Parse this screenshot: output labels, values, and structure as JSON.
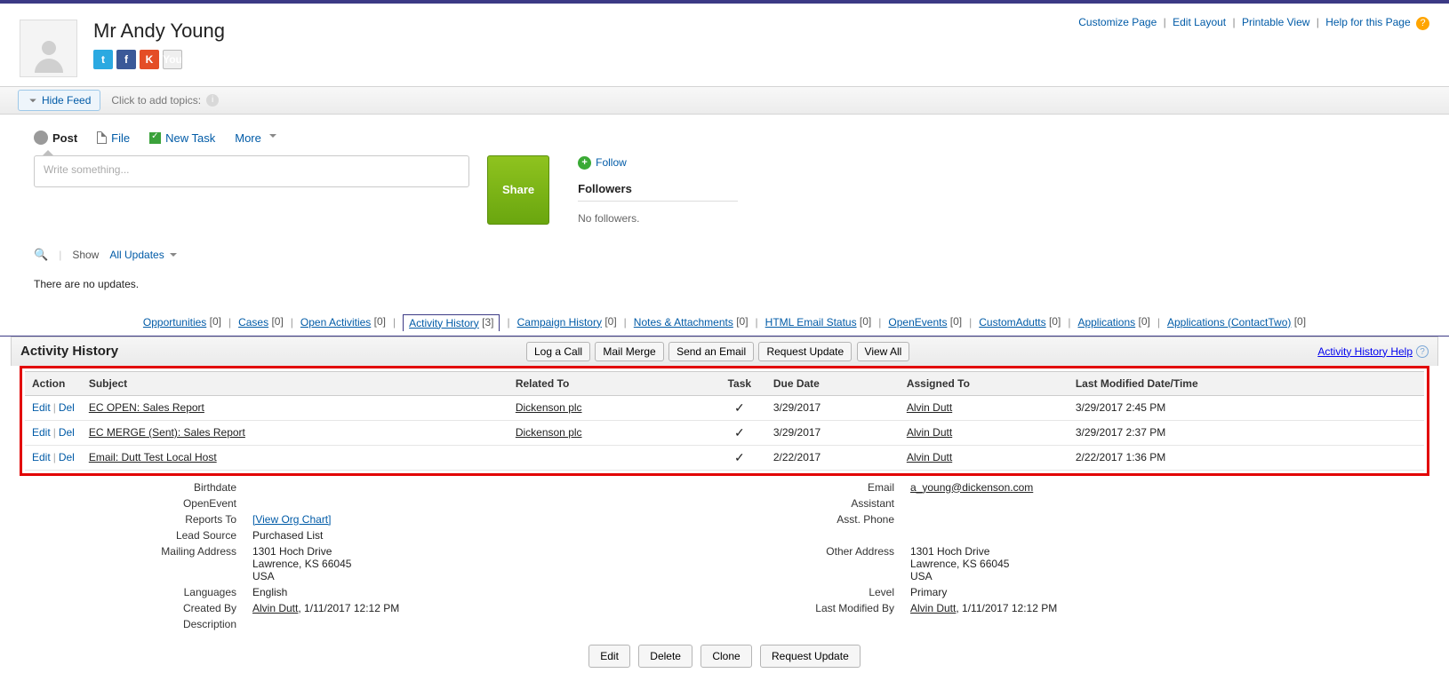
{
  "header": {
    "title": "Mr Andy Young",
    "page_links": {
      "customize": "Customize Page",
      "edit_layout": "Edit Layout",
      "printable": "Printable View",
      "help": "Help for this Page"
    },
    "social": {
      "twitter": "t",
      "facebook": "f",
      "klout": "K",
      "youtube": "You"
    }
  },
  "feedbar": {
    "hide_feed": "Hide Feed",
    "topics_hint": "Click to add topics:"
  },
  "feedtabs": {
    "post": "Post",
    "file": "File",
    "new_task": "New Task",
    "more": "More"
  },
  "feed": {
    "placeholder": "Write something...",
    "share_btn": "Share",
    "follow": "Follow",
    "followers_h": "Followers",
    "no_followers": "No followers."
  },
  "showrow": {
    "show_label": "Show",
    "all_updates": "All Updates",
    "no_updates": "There are no updates."
  },
  "rellinks": [
    {
      "label": "Opportunities",
      "count": "[0]"
    },
    {
      "label": "Cases",
      "count": "[0]"
    },
    {
      "label": "Open Activities",
      "count": "[0]"
    },
    {
      "label": "Activity History",
      "count": "[3]",
      "selected": true
    },
    {
      "label": "Campaign History",
      "count": "[0]"
    },
    {
      "label": "Notes & Attachments",
      "count": "[0]"
    },
    {
      "label": "HTML Email Status",
      "count": "[0]"
    },
    {
      "label": "OpenEvents",
      "count": "[0]"
    },
    {
      "label": "CustomAdutts",
      "count": "[0]"
    },
    {
      "label": "Applications",
      "count": "[0]"
    },
    {
      "label": "Applications (ContactTwo)",
      "count": "[0]"
    }
  ],
  "activity_panel": {
    "title": "Activity History",
    "help": "Activity History Help",
    "buttons": {
      "log_call": "Log a Call",
      "mail_merge": "Mail Merge",
      "send_email": "Send an Email",
      "request_update": "Request Update",
      "view_all": "View All"
    },
    "columns": {
      "action": "Action",
      "subject": "Subject",
      "related_to": "Related To",
      "task": "Task",
      "due_date": "Due Date",
      "assigned_to": "Assigned To",
      "modified": "Last Modified Date/Time"
    },
    "row_actions": {
      "edit": "Edit",
      "del": "Del"
    },
    "rows": [
      {
        "subject": "EC OPEN: Sales Report",
        "related_to": "Dickenson plc",
        "task": "✓",
        "due": "3/29/2017",
        "assigned": "Alvin Dutt",
        "modified": "3/29/2017 2:45 PM"
      },
      {
        "subject": "EC MERGE (Sent): Sales Report",
        "related_to": "Dickenson plc",
        "task": "✓",
        "due": "3/29/2017",
        "assigned": "Alvin Dutt",
        "modified": "3/29/2017 2:37 PM"
      },
      {
        "subject": "Email: Dutt Test Local Host",
        "related_to": "",
        "task": "✓",
        "due": "2/22/2017",
        "assigned": "Alvin Dutt",
        "modified": "2/22/2017 1:36 PM"
      }
    ]
  },
  "detail": {
    "birthdate_lbl": "Birthdate",
    "birthdate": "",
    "email_lbl": "Email",
    "email": "a_young@dickenson.com",
    "openevent_lbl": "OpenEvent",
    "openevent": "",
    "assistant_lbl": "Assistant",
    "assistant": "",
    "reports_to_lbl": "Reports To",
    "reports_to": "[View Org Chart]",
    "asst_phone_lbl": "Asst. Phone",
    "asst_phone": "",
    "lead_source_lbl": "Lead Source",
    "lead_source": "Purchased List",
    "mailing_addr_lbl": "Mailing Address",
    "mailing_addr_l1": "1301 Hoch Drive",
    "mailing_addr_l2": "Lawrence, KS 66045",
    "mailing_addr_l3": "USA",
    "other_addr_lbl": "Other Address",
    "other_addr_l1": "1301 Hoch Drive",
    "other_addr_l2": "Lawrence, KS 66045",
    "other_addr_l3": "USA",
    "languages_lbl": "Languages",
    "languages": "English",
    "level_lbl": "Level",
    "level": "Primary",
    "created_by_lbl": "Created By",
    "created_by_name": "Alvin Dutt",
    "created_by_ts": ", 1/11/2017 12:12 PM",
    "modified_by_lbl": "Last Modified By",
    "modified_by_name": "Alvin Dutt",
    "modified_by_ts": ", 1/11/2017 12:12 PM",
    "description_lbl": "Description",
    "description": ""
  },
  "bottom_buttons": {
    "edit": "Edit",
    "delete": "Delete",
    "clone": "Clone",
    "request_update": "Request Update"
  }
}
